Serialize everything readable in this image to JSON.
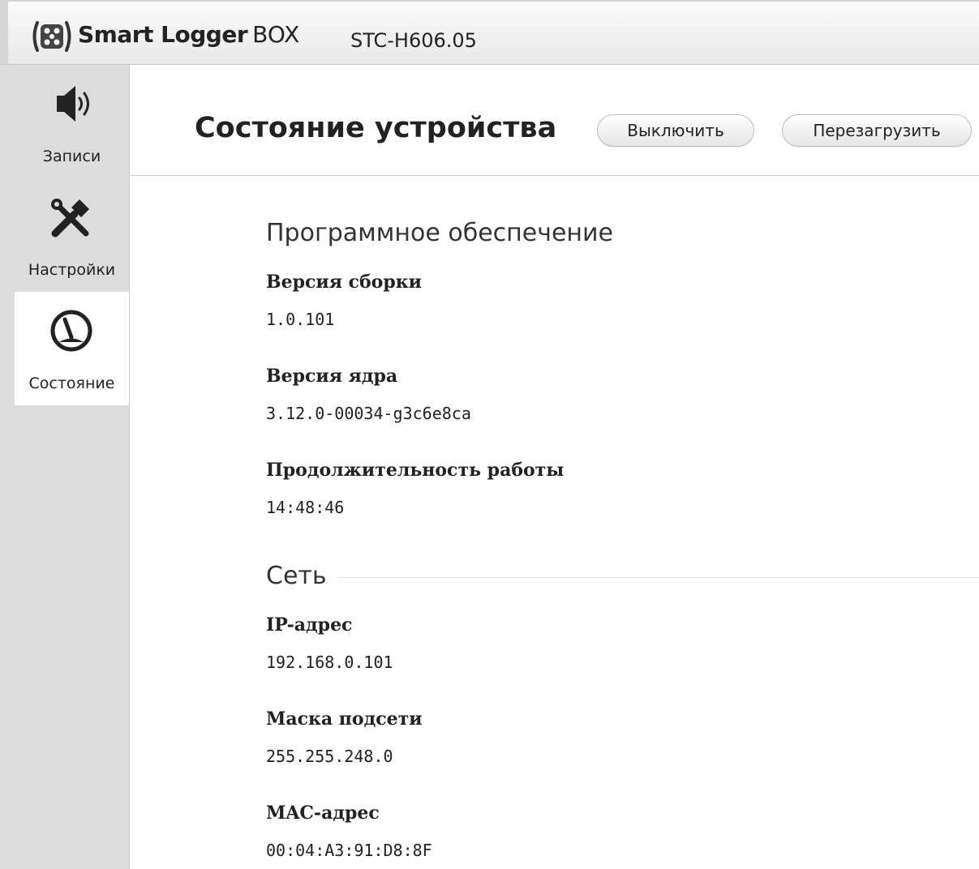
{
  "app": {
    "brand_bold": "Smart Logger",
    "brand_light": "BOX",
    "model": "STC-H606.05"
  },
  "sidebar": {
    "items": [
      {
        "label": "Записи",
        "icon": "speaker-icon",
        "active": false
      },
      {
        "label": "Настройки",
        "icon": "tools-icon",
        "active": false
      },
      {
        "label": "Состояние",
        "icon": "gauge-icon",
        "active": true
      }
    ]
  },
  "page": {
    "title": "Состояние устройства",
    "shutdown_label": "Выключить",
    "reboot_label": "Перезагрузить"
  },
  "software": {
    "title": "Программное обеспечение",
    "build_label": "Версия сборки",
    "build_value": "1.0.101",
    "kernel_label": "Версия ядра",
    "kernel_value": "3.12.0-00034-g3c6e8ca",
    "uptime_label": "Продолжительность работы",
    "uptime_value": "14:48:46"
  },
  "network": {
    "title": "Сеть",
    "ip_label": "IP-адрес",
    "ip_value": "192.168.0.101",
    "mask_label": "Маска подсети",
    "mask_value": "255.255.248.0",
    "mac_label": "MAC-адрес",
    "mac_value": "00:04:A3:91:D8:8F"
  }
}
